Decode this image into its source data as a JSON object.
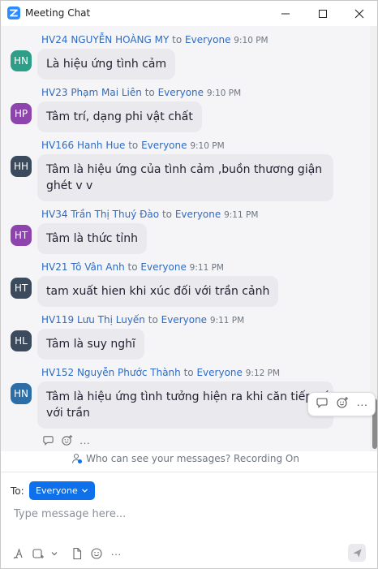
{
  "window": {
    "title": "Meeting Chat",
    "icons": {
      "app": "zoom-logo-icon",
      "minimize": "minimize-icon",
      "maximize": "maximize-icon",
      "close": "close-icon"
    }
  },
  "messages": [
    {
      "avatar": "HN",
      "avatar_color": "#2e9e88",
      "sender": "HV24 NGUYỄN HOÀNG MY",
      "to": "to",
      "target": "Everyone",
      "time": "9:10 PM",
      "lines": [
        "Là hiệu ứng tình cảm"
      ]
    },
    {
      "avatar": "HP",
      "avatar_color": "#8e44ad",
      "sender": "HV23 Phạm Mai Liên",
      "to": "to",
      "target": "Everyone",
      "time": "9:10 PM",
      "lines": [
        "Tâm trí, dạng phi vật chất"
      ]
    },
    {
      "avatar": "HH",
      "avatar_color": "#3b4a5c",
      "sender": "HV166 Hanh Hue",
      "to": "to",
      "target": "Everyone",
      "time": "9:10 PM",
      "lines": [
        "Tâm là hiệu ứng của tình cảm ,buồn thương giận",
        "ghét v v"
      ]
    },
    {
      "avatar": "HT",
      "avatar_color": "#8e44ad",
      "sender": "HV34 Trần Thị Thuý Đào",
      "to": "to",
      "target": "Everyone",
      "time": "9:11 PM",
      "lines": [
        "Tâm là thức tỉnh"
      ]
    },
    {
      "avatar": "HT",
      "avatar_color": "#3b4a5c",
      "sender": "HV21 Tô Vân Anh",
      "to": "to",
      "target": "Everyone",
      "time": "9:11 PM",
      "lines": [
        "tam xuất hien khi xúc đối với trần cảnh"
      ]
    },
    {
      "avatar": "HL",
      "avatar_color": "#3b4a5c",
      "sender": "HV119 Lưu Thị Luyến",
      "to": "to",
      "target": "Everyone",
      "time": "9:11 PM",
      "lines": [
        "Tâm là suy nghĩ"
      ]
    },
    {
      "avatar": "HN",
      "avatar_color": "#2c6fa8",
      "sender": "HV152 Nguyễn Phước Thành",
      "to": "to",
      "target": "Everyone",
      "time": "9:12 PM",
      "lines": [
        "Tâm là hiệu ứng tình tưởng hiện ra khi căn tiếp xúc",
        "với trần"
      ]
    }
  ],
  "message_actions": {
    "reply_icon": "reply-icon",
    "emoji_icon": "add-reaction-icon",
    "more_icon": "more-icon",
    "more_label": "···"
  },
  "reaction_row": {
    "reply_icon": "reply-icon",
    "emoji_icon": "add-reaction-icon",
    "more_label": "···"
  },
  "privacy": {
    "text": "Who can see your messages? Recording On",
    "icon": "people-lock-icon"
  },
  "composer": {
    "to_label": "To:",
    "recipient": "Everyone",
    "placeholder": "Type message here...",
    "more_label": "···",
    "toolbar_icons": [
      "format-icon",
      "screenshot-icon",
      "chevron-down-icon",
      "file-icon",
      "emoji-icon",
      "more-icon"
    ],
    "send_icon": "send-icon"
  },
  "colors": {
    "accent": "#0e71eb",
    "link": "#2d6bc4",
    "bubble": "#e9e9ee",
    "chat_bg": "#f5f5f8"
  }
}
